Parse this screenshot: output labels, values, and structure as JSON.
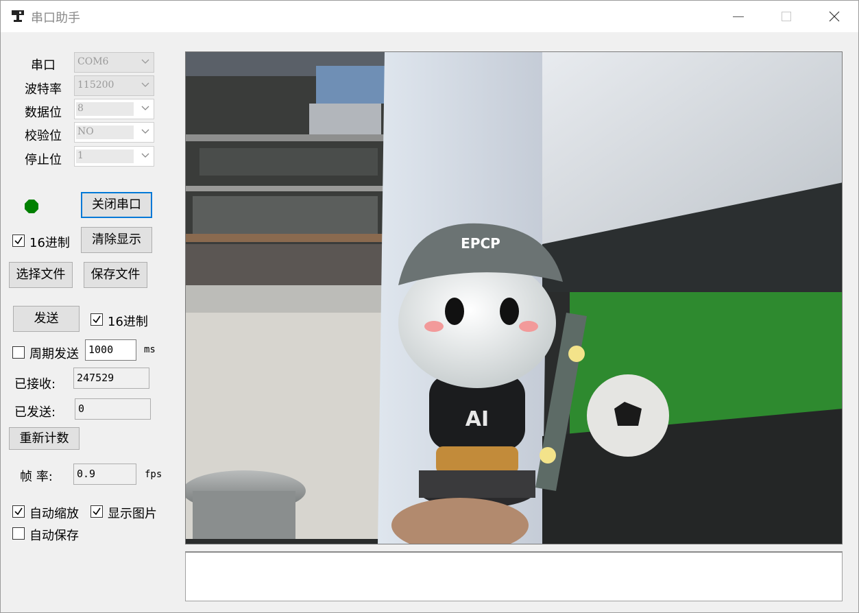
{
  "window": {
    "title": "串口助手"
  },
  "port_settings": {
    "port": {
      "label": "串口",
      "value": "COM6"
    },
    "baud": {
      "label": "波特率",
      "value": "115200"
    },
    "data_bits": {
      "label": "数据位",
      "value": "8"
    },
    "parity": {
      "label": "校验位",
      "value": "NO"
    },
    "stop_bits": {
      "label": "停止位",
      "value": "1"
    }
  },
  "status": {
    "led_color": "#008000"
  },
  "buttons": {
    "close_port": "关闭串口",
    "clear_display": "清除显示",
    "select_file": "选择文件",
    "save_file": "保存文件",
    "send": "发送",
    "reset_count": "重新计数"
  },
  "receive_options": {
    "hex_label": "16进制",
    "hex_checked": true
  },
  "send_options": {
    "hex_label": "16进制",
    "hex_checked": true,
    "periodic_label": "周期发送",
    "periodic_checked": false,
    "period_value": "1000",
    "period_unit": "ms"
  },
  "counters": {
    "received_label": "已接收:",
    "received_value": "247529",
    "sent_label": "已发送:",
    "sent_value": "0"
  },
  "frame_rate": {
    "label": "帧 率:",
    "value": "0.9",
    "unit": "fps"
  },
  "display_options": {
    "auto_zoom_label": "自动缩放",
    "auto_zoom_checked": true,
    "show_image_label": "显示图片",
    "show_image_checked": true,
    "auto_save_label": "自动保存",
    "auto_save_checked": false
  },
  "image_view": {
    "figure_cap_text": "EPCP",
    "figure_shirt_text": "AI"
  },
  "output": {
    "value": ""
  }
}
